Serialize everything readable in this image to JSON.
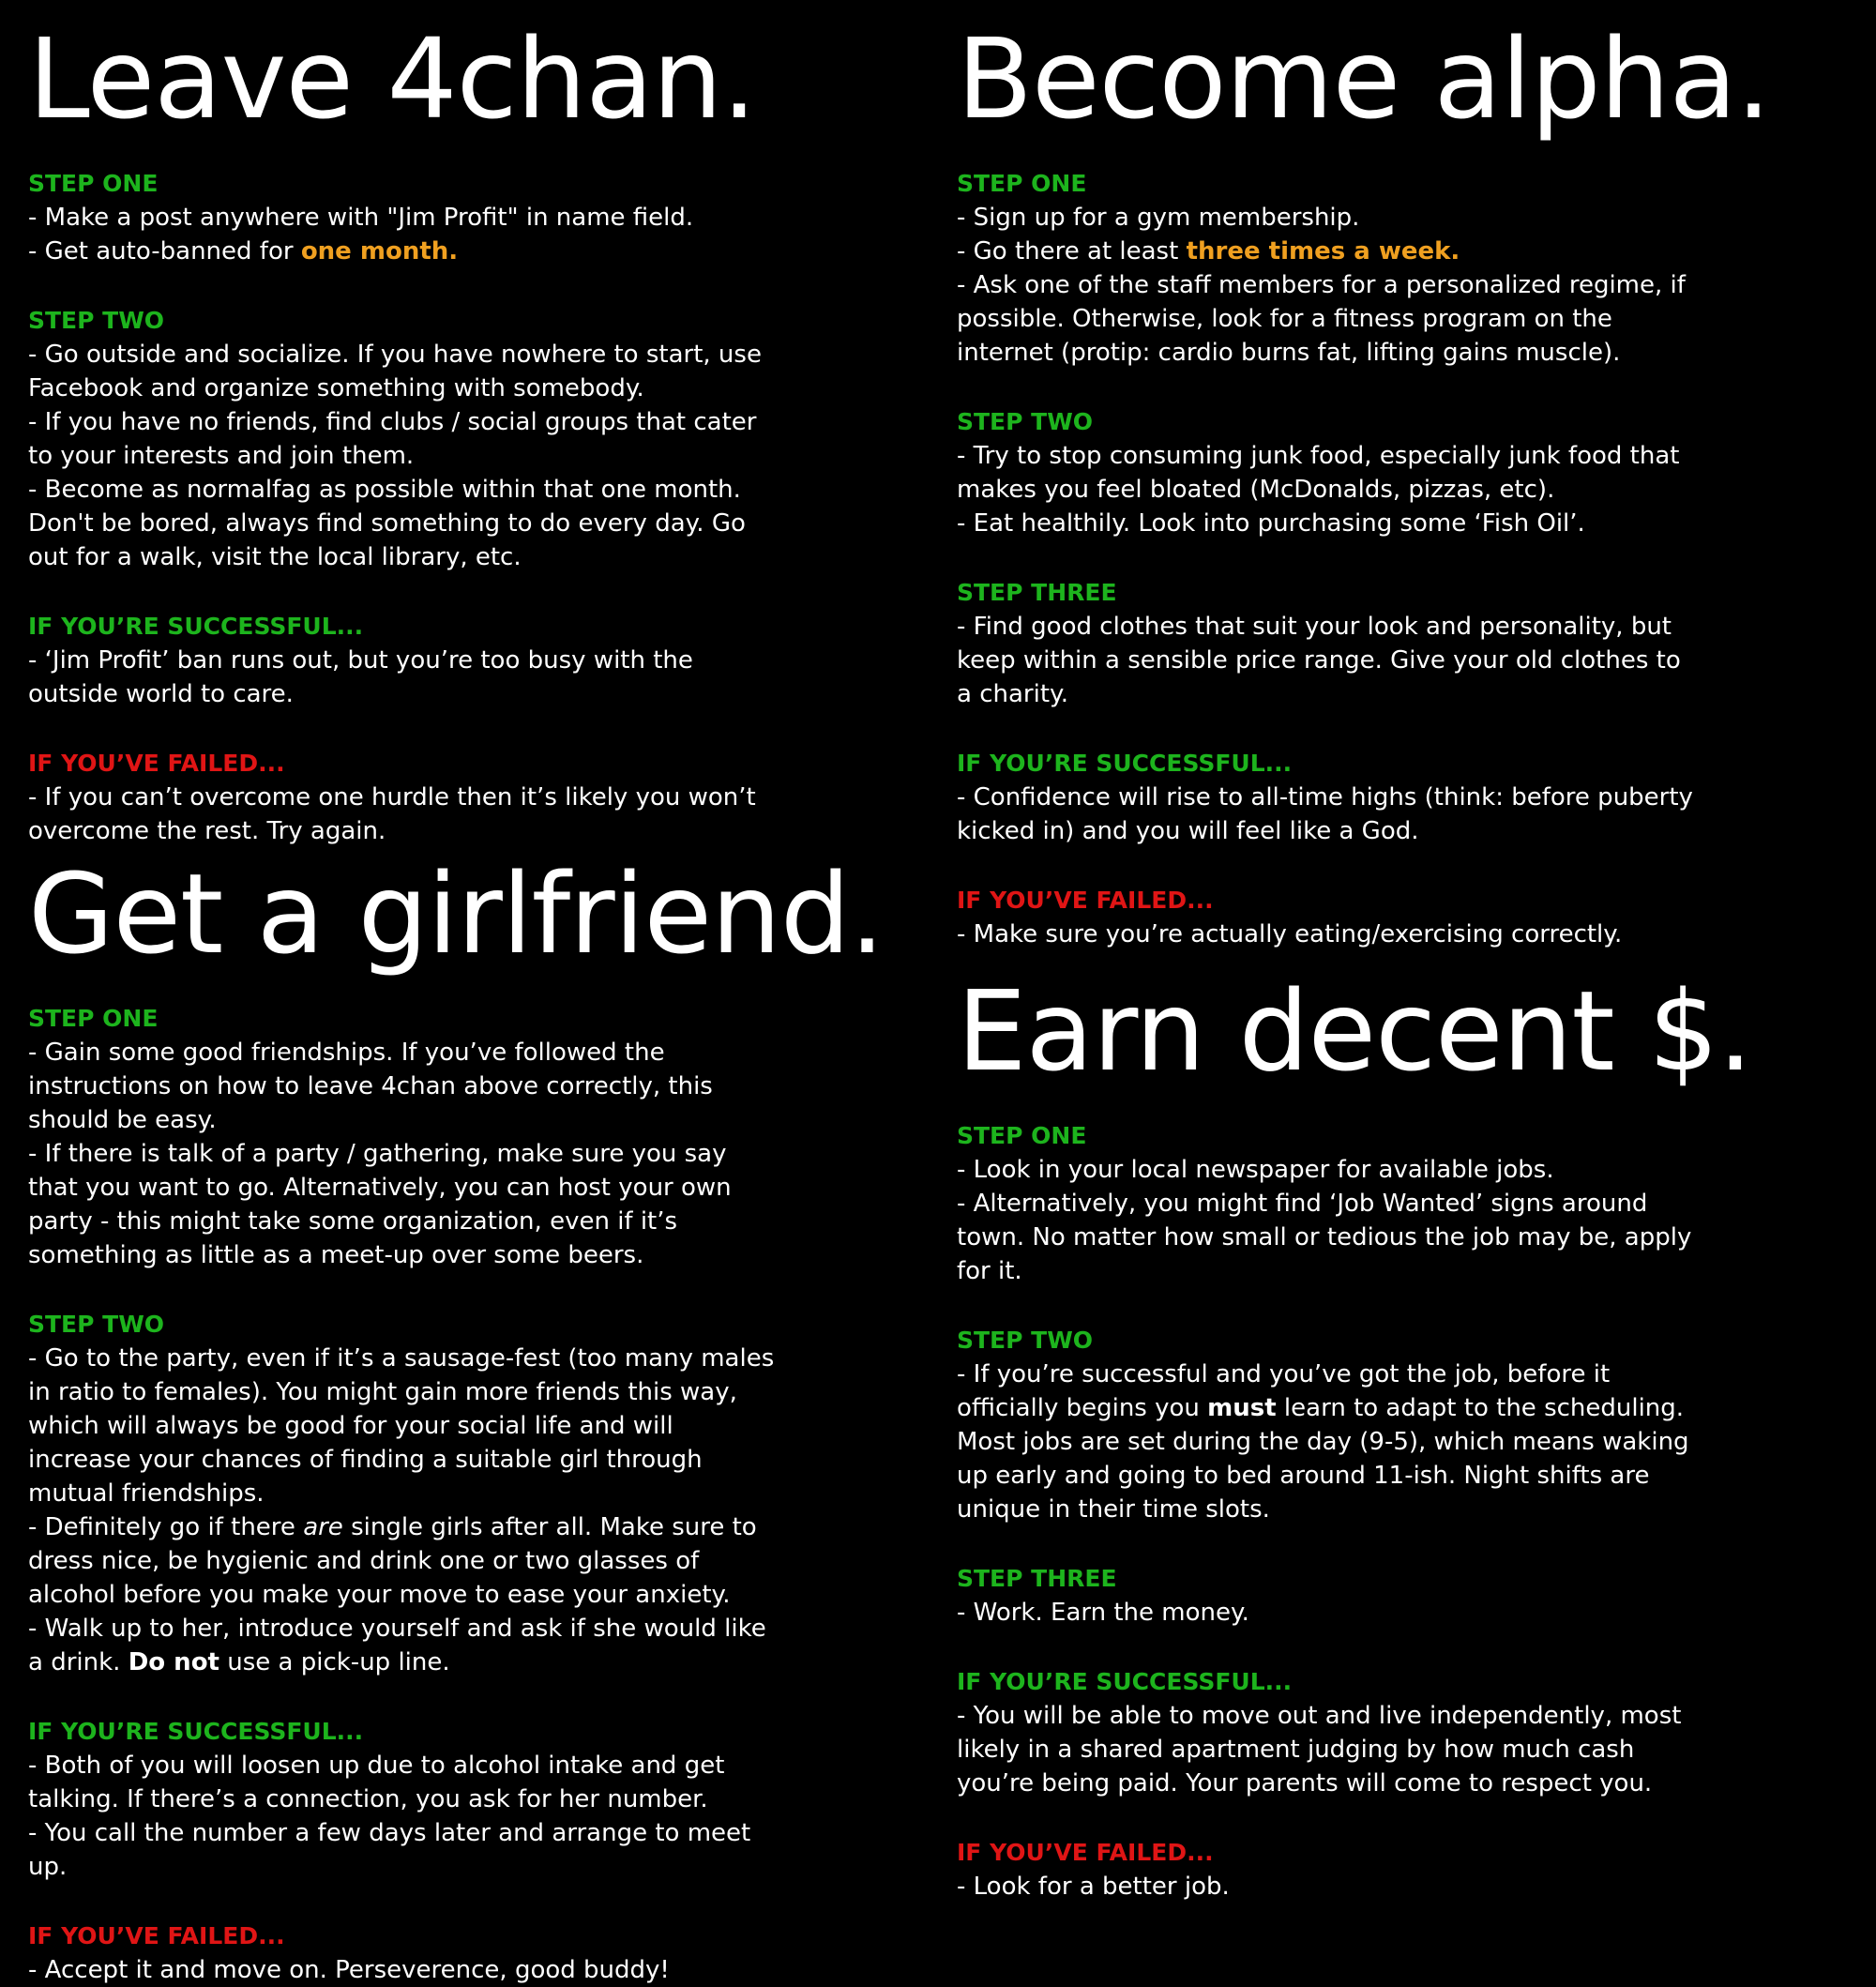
{
  "leave": {
    "title": "Leave 4chan.",
    "s1": {
      "heading": "STEP ONE",
      "l1": "- Make a post anywhere with \"Jim Profit\" in name field.",
      "l2a": "- Get auto-banned for ",
      "l2b": "one month."
    },
    "s2": {
      "heading": "STEP TWO",
      "l1": "- Go outside and socialize. If you have nowhere to start, use Facebook and organize something with somebody.",
      "l2": "- If you have no friends, find clubs / social groups that cater to your interests and join them.",
      "l3": "- Become as normalfag as possible within that one month. Don't be bored, always find something to do every day. Go out for a walk, visit the local library, etc."
    },
    "ok": {
      "heading": "IF YOU’RE SUCCESSFUL...",
      "l1": "- ‘Jim Profit’ ban runs out, but you’re too busy with the outside world to care."
    },
    "fail": {
      "heading": "IF YOU’VE FAILED...",
      "l1": "- If you can’t overcome one hurdle then it’s likely you won’t overcome the rest. Try again."
    }
  },
  "alpha": {
    "title": "Become alpha.",
    "s1": {
      "heading": "STEP ONE",
      "l1": "- Sign up for a gym membership.",
      "l2a": "- Go there at least ",
      "l2b": "three times a week.",
      "l3": "- Ask one of the staff members for a personalized regime, if possible. Otherwise, look for a fitness program on the internet (protip: cardio burns fat, lifting gains muscle)."
    },
    "s2": {
      "heading": "STEP TWO",
      "l1": "- Try to stop consuming junk food, especially junk food that makes you feel bloated (McDonalds, pizzas, etc).",
      "l2": "- Eat healthily. Look into purchasing some ‘Fish Oil’."
    },
    "s3": {
      "heading": "STEP THREE",
      "l1": "- Find good clothes that suit your look and personality, but keep within a sensible price range. Give your old clothes to a charity."
    },
    "ok": {
      "heading": "IF YOU’RE SUCCESSFUL...",
      "l1": "- Confidence will rise to all-time highs (think: before puberty kicked in) and you will feel like a God."
    },
    "fail": {
      "heading": "IF YOU’VE FAILED...",
      "l1": "- Make sure you’re actually eating/exercising correctly."
    }
  },
  "gf": {
    "title": "Get a girlfriend.",
    "s1": {
      "heading": "STEP ONE",
      "l1": "- Gain some good friendships. If you’ve followed the instructions on how to leave 4chan above correctly, this should be easy.",
      "l2": "- If there is talk of a party / gathering, make sure you say that you want to go. Alternatively, you can host your own party - this might take some organization, even if it’s something as little as a meet-up over some beers."
    },
    "s2": {
      "heading": "STEP TWO",
      "l1": "- Go to the party, even if it’s a sausage-fest (too many males in ratio to females). You might gain more friends this way, which will always be good for your social life and will increase your chances of finding a suitable girl through mutual friendships.",
      "l2a": "- Definitely go if there ",
      "l2b": "are",
      "l2c": " single girls after all. Make sure to dress nice, be hygienic and drink one or two glasses of alcohol before you make your move to ease your anxiety.",
      "l3a": "- Walk up to her, introduce yourself and ask if she would like a drink. ",
      "l3b": "Do not",
      "l3c": " use a pick-up line."
    },
    "ok": {
      "heading": "IF YOU’RE SUCCESSFUL...",
      "l1": "- Both of you will loosen up due to alcohol intake and get talking. If there’s a connection, you ask for her number.",
      "l2": "- You call the number a few days later and arrange to meet up."
    },
    "fail": {
      "heading": "IF YOU’VE FAILED...",
      "l1": "- Accept it and move on. Perseverence, good buddy!"
    }
  },
  "money": {
    "title": "Earn decent $.",
    "s1": {
      "heading": "STEP ONE",
      "l1": "- Look in your local newspaper for available jobs.",
      "l2": "- Alternatively, you might find ‘Job Wanted’ signs around town. No matter how small or tedious the job may be, apply for it."
    },
    "s2": {
      "heading": "STEP TWO",
      "l1a": "- If you’re successful and you’ve got the job, before it officially begins you ",
      "l1b": "must",
      "l1c": " learn to adapt to the scheduling. Most jobs are set during the day (9-5), which means waking up early and going to bed around 11-ish. Night shifts are unique in their time slots."
    },
    "s3": {
      "heading": "STEP THREE",
      "l1": "- Work. Earn the money."
    },
    "ok": {
      "heading": "IF YOU’RE SUCCESSFUL...",
      "l1": "- You will be able to move out and live independently, most likely in a shared apartment judging by how much cash you’re being paid. Your parents will come to respect you."
    },
    "fail": {
      "heading": "IF YOU’VE FAILED...",
      "l1": "- Look for a better job."
    }
  }
}
